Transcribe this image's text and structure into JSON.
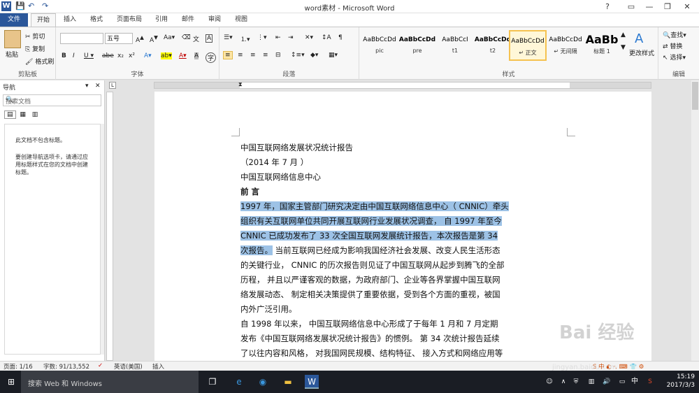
{
  "window": {
    "title": "word素材 - Microsoft Word"
  },
  "quick_access": {
    "save": "💾",
    "undo": "↶",
    "redo": "↷"
  },
  "tabs": [
    {
      "label": "文件"
    },
    {
      "label": "开始"
    },
    {
      "label": "插入"
    },
    {
      "label": "格式"
    },
    {
      "label": "页面布局"
    },
    {
      "label": "引用"
    },
    {
      "label": "邮件"
    },
    {
      "label": "审阅"
    },
    {
      "label": "视图"
    }
  ],
  "ribbon": {
    "clipboard": {
      "paste": "粘贴",
      "cut": "剪切",
      "copy": "复制",
      "format_painter": "格式刷",
      "label": "剪贴板"
    },
    "font": {
      "font_name": "",
      "font_size": "五号",
      "label": "字体"
    },
    "paragraph": {
      "label": "段落"
    },
    "styles": {
      "label": "样式",
      "items": [
        {
          "preview": "AaBbCcDd",
          "name": "pic"
        },
        {
          "preview": "AaBbCcDd",
          "name": "pre"
        },
        {
          "preview": "AaBbCcI",
          "name": "t1"
        },
        {
          "preview": "AaBbCcDd",
          "name": "t2"
        },
        {
          "preview": "AaBbCcDd",
          "name": "↵ 正文"
        },
        {
          "preview": "AaBbCcDd",
          "name": "↵ 无间隔"
        },
        {
          "preview": "AaBb",
          "name": "标题 1"
        }
      ],
      "change": "更改样式"
    },
    "editing": {
      "find": "查找",
      "replace": "替换",
      "select": "选择",
      "label": "编辑"
    }
  },
  "nav_pane": {
    "title": "导航",
    "search_placeholder": "搜索文档",
    "msg1": "此文档不包含标题。",
    "msg2": "要创建导航选项卡，请通过应用标题样式在您的文档中创建标题。"
  },
  "document": {
    "lines": [
      {
        "text": "中国互联网络发展状况统计报告",
        "bold": false,
        "hl": false
      },
      {
        "text": "（2014 年 7 月 ）",
        "bold": false,
        "hl": false
      },
      {
        "text": "中国互联网络信息中心",
        "bold": false,
        "hl": false
      },
      {
        "text": "前 言",
        "bold": true,
        "hl": false
      },
      {
        "text": "1997 年，国家主管部门研究决定由中国互联网络信息中心（ CNNIC）牵头",
        "bold": false,
        "hl": true
      },
      {
        "text": "组织有关互联网单位共同开展互联网行业发展状况调查， 自 1997 年至今",
        "bold": false,
        "hl": true
      },
      {
        "text": "CNNIC 已成功发布了 33 次全国互联网发展统计报告，本次报告是第 34",
        "bold": false,
        "hl": true
      },
      {
        "text": "次报告。",
        "tail": " 当前互联网已经成为影响我国经济社会发展、改变人民生活形态",
        "bold": false,
        "hl": "partial"
      },
      {
        "text": "的关键行业， CNNIC 的历次报告则见证了中国互联网从起步到腾飞的全部",
        "bold": false,
        "hl": false
      },
      {
        "text": "历程， 并且以严谨客观的数据，为政府部门、企业等各界掌握中国互联网",
        "bold": false,
        "hl": false
      },
      {
        "text": "络发展动态、 制定相关决策提供了重要依据，受到各个方面的重视，被国",
        "bold": false,
        "hl": false
      },
      {
        "text": "内外广泛引用。",
        "bold": false,
        "hl": false
      },
      {
        "text": "自 1998 年以来， 中国互联网络信息中心形成了于每年 1 月和 7 月定期",
        "bold": false,
        "hl": false
      },
      {
        "text": "发布《中国互联网络发展状况统计报告》的惯例。 第 34 次统计报告延续",
        "bold": false,
        "hl": false
      },
      {
        "text": "了以往内容和风格， 对我国网民规模、结构特征、 接入方式和网络应用等",
        "bold": false,
        "hl": false
      }
    ]
  },
  "status": {
    "page": "页面: 1/16",
    "words": "字数: 91/13,552",
    "lang": "英语(美国)",
    "mode": "插入"
  },
  "taskbar": {
    "search": "搜索 Web 和 Windows",
    "time": "15:19",
    "date": "2017/3/3",
    "ime": "中"
  },
  "watermark": {
    "text": "Bai 经验",
    "url": "jingyan.baidu.com"
  }
}
